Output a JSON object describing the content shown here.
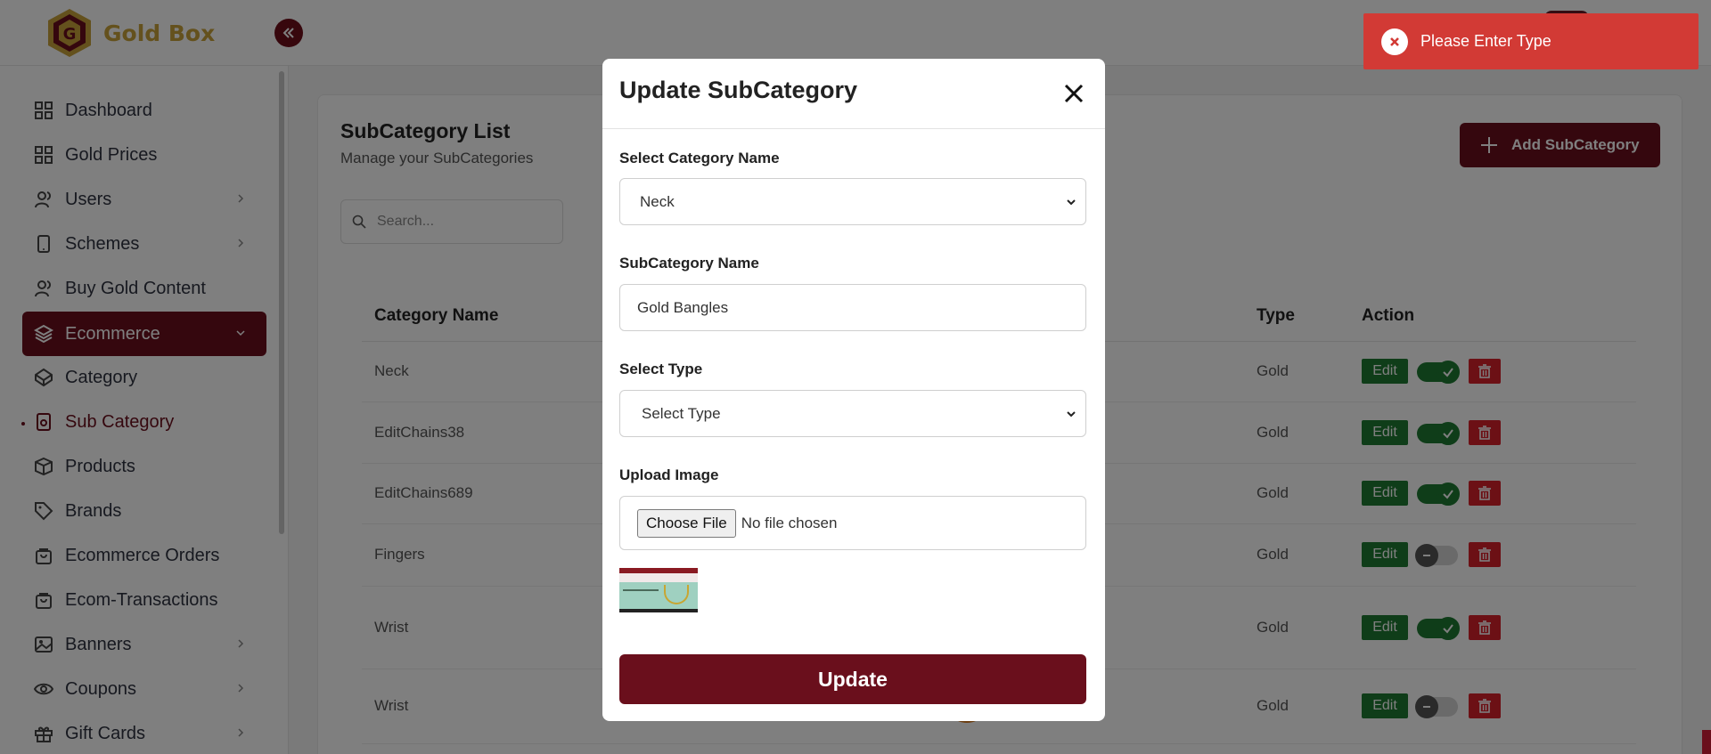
{
  "header": {
    "brand": "Gold Box"
  },
  "sidebar": {
    "items": [
      {
        "label": "Dashboard",
        "icon": "grid-icon"
      },
      {
        "label": "Gold Prices",
        "icon": "grid-icon"
      },
      {
        "label": "Users",
        "icon": "users-icon",
        "chevron": true
      },
      {
        "label": "Schemes",
        "icon": "tablet-icon",
        "chevron": true
      },
      {
        "label": "Buy Gold Content",
        "icon": "users-icon"
      },
      {
        "label": "Ecommerce",
        "icon": "layers-icon",
        "chevron": true,
        "active": true
      },
      {
        "label": "Category",
        "icon": "codepen-icon"
      },
      {
        "label": "Sub Category",
        "icon": "box-icon"
      },
      {
        "label": "Products",
        "icon": "cube-icon"
      },
      {
        "label": "Brands",
        "icon": "tag-icon"
      },
      {
        "label": "Ecommerce Orders",
        "icon": "bag-icon"
      },
      {
        "label": "Ecom-Transactions",
        "icon": "bag-icon"
      },
      {
        "label": "Banners",
        "icon": "image-icon",
        "chevron": true
      },
      {
        "label": "Coupons",
        "icon": "eye-icon",
        "chevron": true
      },
      {
        "label": "Gift Cards",
        "icon": "gift-icon",
        "chevron": true
      }
    ]
  },
  "page": {
    "title": "SubCategory List",
    "subtitle": "Manage your SubCategories",
    "search_placeholder": "Search...",
    "add_button": "Add SubCategory"
  },
  "table": {
    "headers": {
      "category": "Category Name",
      "type": "Type",
      "action": "Action"
    },
    "edit_label": "Edit",
    "rows": [
      {
        "category": "Neck",
        "type": "Gold",
        "active": true
      },
      {
        "category": "EditChains38",
        "type": "Gold",
        "active": true
      },
      {
        "category": "EditChains689",
        "type": "Gold",
        "active": true
      },
      {
        "category": "Fingers",
        "type": "Gold",
        "active": false
      },
      {
        "category": "Wrist",
        "type": "Gold",
        "active": true
      },
      {
        "category": "Wrist",
        "type": "Gold",
        "active": false
      }
    ]
  },
  "modal": {
    "title": "Update SubCategory",
    "category_label": "Select Category Name",
    "category_value": "Neck",
    "name_label": "SubCategory Name",
    "name_value": "Gold Bangles",
    "type_label": "Select Type",
    "type_value": "Select Type",
    "upload_label": "Upload Image",
    "choose_file": "Choose File",
    "no_file": "No file chosen",
    "update_button": "Update"
  },
  "toast": {
    "message": "Please Enter Type"
  },
  "colors": {
    "brand": "#6a0f1c",
    "gold": "#c9a23a",
    "success": "#1f7a33",
    "danger": "#d8202a",
    "toast": "#d23a35"
  }
}
